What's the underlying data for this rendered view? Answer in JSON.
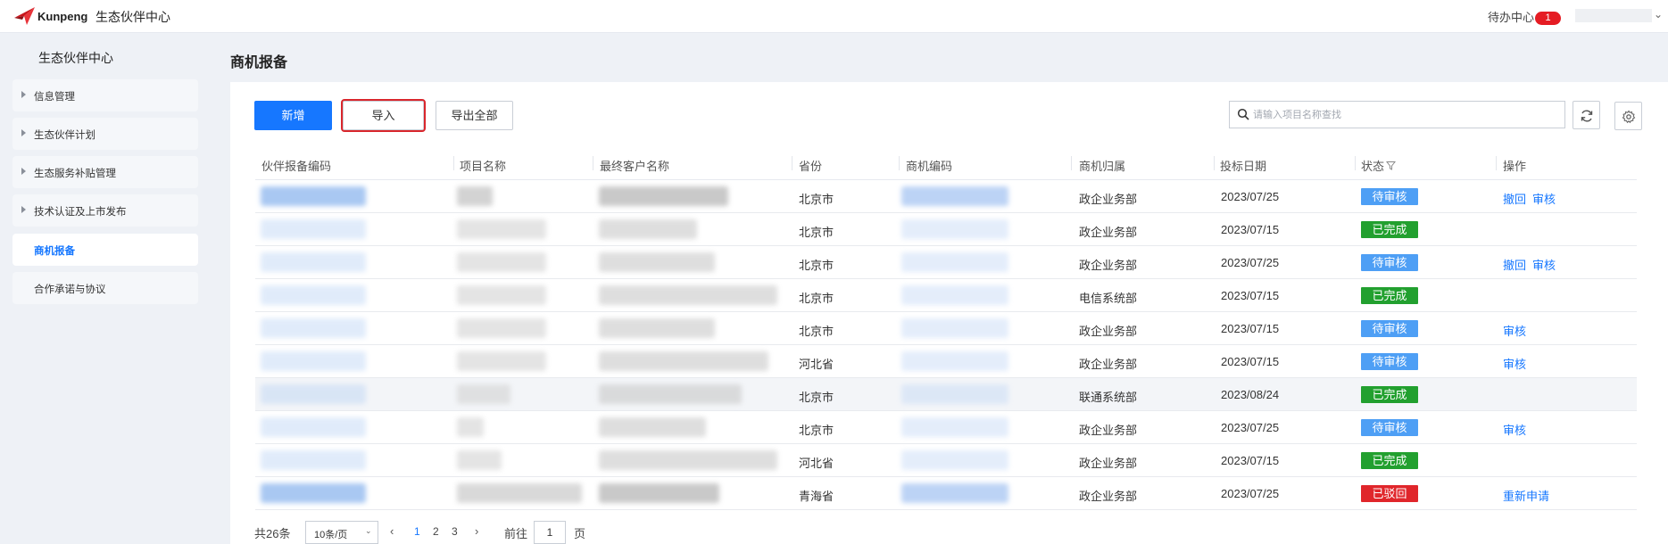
{
  "header": {
    "brand": "Kunpeng",
    "app_title": "生态伙伴中心",
    "todo_label": "待办中心",
    "todo_count": "1"
  },
  "sidebar": {
    "title": "生态伙伴中心",
    "items": [
      {
        "label": "信息管理",
        "expandable": true
      },
      {
        "label": "生态伙伴计划",
        "expandable": true
      },
      {
        "label": "生态服务补贴管理",
        "expandable": true
      },
      {
        "label": "技术认证及上市发布",
        "expandable": true
      },
      {
        "label": "商机报备",
        "expandable": false,
        "active": true
      },
      {
        "label": "合作承诺与协议",
        "expandable": false
      }
    ]
  },
  "page": {
    "title": "商机报备"
  },
  "toolbar": {
    "add_label": "新增",
    "import_label": "导入",
    "export_label": "导出全部",
    "search_placeholder": "请输入项目名称查找"
  },
  "table": {
    "columns": [
      "伙伴报备编码",
      "项目名称",
      "最终客户名称",
      "省份",
      "商机编码",
      "商机归属",
      "投标日期",
      "状态",
      "操作"
    ],
    "rows": [
      {
        "province": "北京市",
        "belong": "政企业务部",
        "date": "2023/07/25",
        "status": "待审核",
        "status_type": "pending",
        "actions": [
          "撤回",
          "审核"
        ]
      },
      {
        "province": "北京市",
        "belong": "政企业务部",
        "date": "2023/07/15",
        "status": "已完成",
        "status_type": "done",
        "actions": []
      },
      {
        "province": "北京市",
        "belong": "政企业务部",
        "date": "2023/07/25",
        "status": "待审核",
        "status_type": "pending",
        "actions": [
          "撤回",
          "审核"
        ]
      },
      {
        "province": "北京市",
        "belong": "电信系统部",
        "date": "2023/07/15",
        "status": "已完成",
        "status_type": "done",
        "actions": []
      },
      {
        "province": "北京市",
        "belong": "政企业务部",
        "date": "2023/07/15",
        "status": "待审核",
        "status_type": "pending",
        "actions": [
          "审核"
        ]
      },
      {
        "province": "河北省",
        "belong": "政企业务部",
        "date": "2023/07/15",
        "status": "待审核",
        "status_type": "pending",
        "actions": [
          "审核"
        ]
      },
      {
        "province": "北京市",
        "belong": "联通系统部",
        "date": "2023/08/24",
        "status": "已完成",
        "status_type": "done",
        "actions": []
      },
      {
        "province": "北京市",
        "belong": "政企业务部",
        "date": "2023/07/25",
        "status": "待审核",
        "status_type": "pending",
        "actions": [
          "审核"
        ]
      },
      {
        "province": "河北省",
        "belong": "政企业务部",
        "date": "2023/07/15",
        "status": "已完成",
        "status_type": "done",
        "actions": []
      },
      {
        "province": "青海省",
        "belong": "政企业务部",
        "date": "2023/07/25",
        "status": "已驳回",
        "status_type": "rejected",
        "actions": [
          "重新申请"
        ]
      }
    ]
  },
  "pagination": {
    "total_label": "共26条",
    "page_size": "10条/页",
    "pages": [
      "1",
      "2",
      "3"
    ],
    "current_page": "1",
    "goto_label": "前往",
    "goto_value": "1",
    "page_unit": "页"
  },
  "colors": {
    "primary": "#1677ff",
    "pending": "#4e9ff5",
    "done": "#22a02f",
    "rejected": "#e0262b",
    "highlight_outline": "#d9262c"
  }
}
